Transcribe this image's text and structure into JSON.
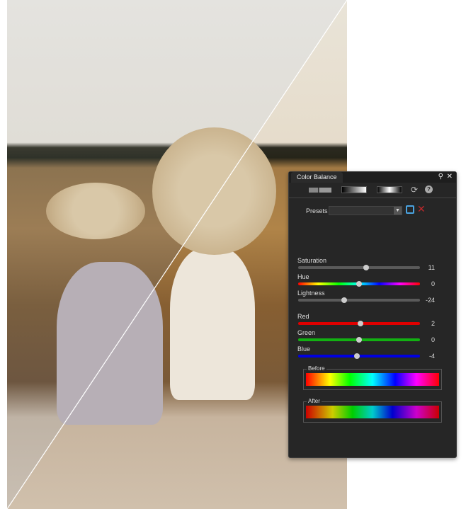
{
  "panel": {
    "title": "Color Balance",
    "pin_icon": "pin-icon",
    "close_icon": "close-icon",
    "presets_label": "Presets",
    "presets_value": "",
    "sliders": [
      {
        "label": "Saturation",
        "value": "11",
        "fraction": 0.56
      },
      {
        "label": "Hue",
        "value": "0",
        "fraction": 0.5
      },
      {
        "label": "Lightness",
        "value": "-24",
        "fraction": 0.38
      },
      {
        "label": "Red",
        "value": "2",
        "fraction": 0.51
      },
      {
        "label": "Green",
        "value": "0",
        "fraction": 0.5
      },
      {
        "label": "Blue",
        "value": "-4",
        "fraction": 0.48
      }
    ],
    "before_label": "Before",
    "after_label": "After"
  },
  "colors": {
    "panel_bg": "#262626",
    "red": "#e00000",
    "green": "#12b012",
    "blue": "#0000e0"
  }
}
